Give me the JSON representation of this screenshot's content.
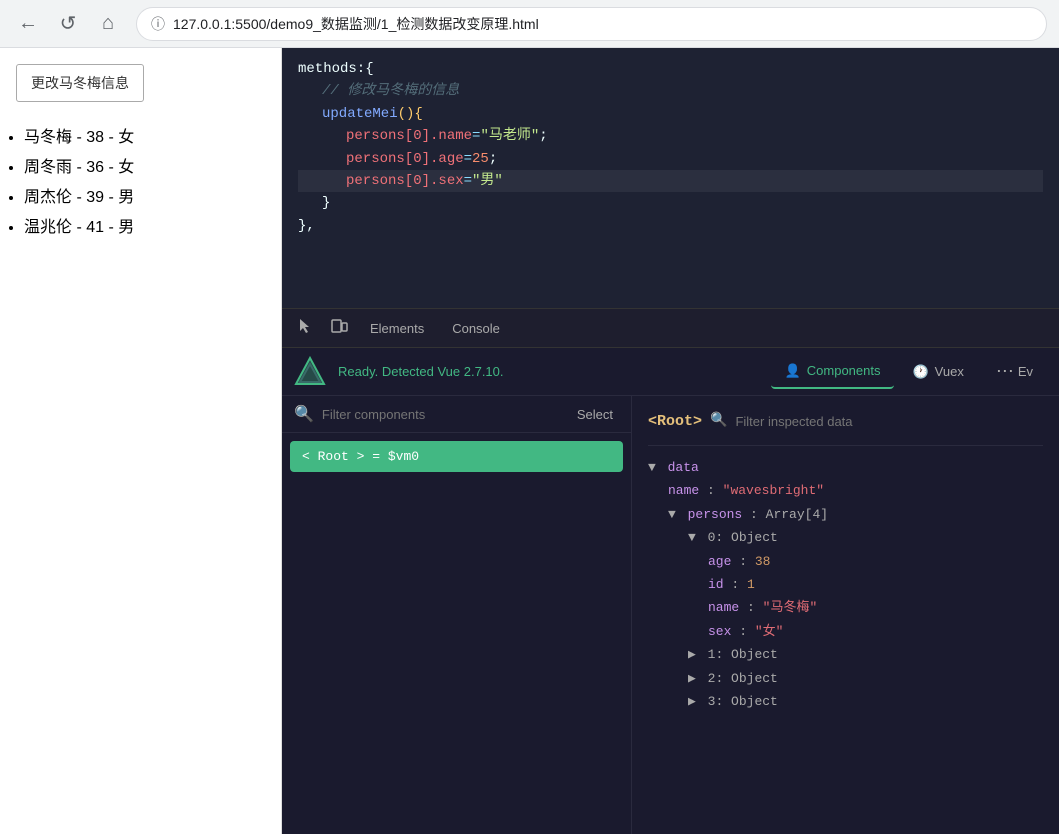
{
  "browser": {
    "url": "127.0.0.1:5500/demo9_数据监测/1_检测数据改变原理.html",
    "back_icon": "←",
    "forward_icon": "→",
    "refresh_icon": "↺",
    "home_icon": "⌂",
    "info_icon": "ⓘ"
  },
  "webpage": {
    "button_label": "更改马冬梅信息",
    "persons": [
      "马冬梅 - 38 - 女",
      "周冬雨 - 36 - 女",
      "周杰伦 - 39 - 男",
      "温兆伦 - 41 - 男"
    ]
  },
  "code": {
    "lines": [
      {
        "indent": 0,
        "content": "methods: {"
      },
      {
        "indent": 1,
        "content": "// 修改马冬梅的信息",
        "type": "comment"
      },
      {
        "indent": 1,
        "content": "updateMei(){",
        "type": "method"
      },
      {
        "indent": 2,
        "content": "persons[0].name = \"马老师\";"
      },
      {
        "indent": 2,
        "content": "persons[0].age = 25;"
      },
      {
        "indent": 2,
        "content": "persons[0].sex = \"男\"",
        "highlighted": true
      },
      {
        "indent": 1,
        "content": "}"
      },
      {
        "indent": 0,
        "content": "},"
      }
    ]
  },
  "devtools": {
    "select_icon": "⬚",
    "inspect_icon": "⬕",
    "elements_tab": "Elements",
    "console_tab": "Console"
  },
  "vue_devtools": {
    "status": "Ready. Detected Vue 2.7.10.",
    "tabs": [
      {
        "label": "Components",
        "icon": "👤",
        "active": true
      },
      {
        "label": "Vuex",
        "icon": "🕐",
        "active": false
      },
      {
        "label": "Ev",
        "icon": "⋯",
        "active": false
      }
    ],
    "search_placeholder": "Filter components",
    "select_label": "Select",
    "root_tag": "<Root>",
    "root_vm": "= $vm0",
    "filter_data_placeholder": "Filter inspected data",
    "data": {
      "section": "data",
      "name_key": "name",
      "name_val": "\"wavesbright\"",
      "persons_key": "persons",
      "persons_meta": "Array[4]",
      "item0": {
        "label": "0: Object",
        "age_key": "age",
        "age_val": "38",
        "id_key": "id",
        "id_val": "1",
        "name_key": "name",
        "name_val": "\"马冬梅\"",
        "sex_key": "sex",
        "sex_val": "\"女\""
      },
      "item1": "1: Object",
      "item2": "2: Object",
      "item3": "3: Object"
    }
  }
}
